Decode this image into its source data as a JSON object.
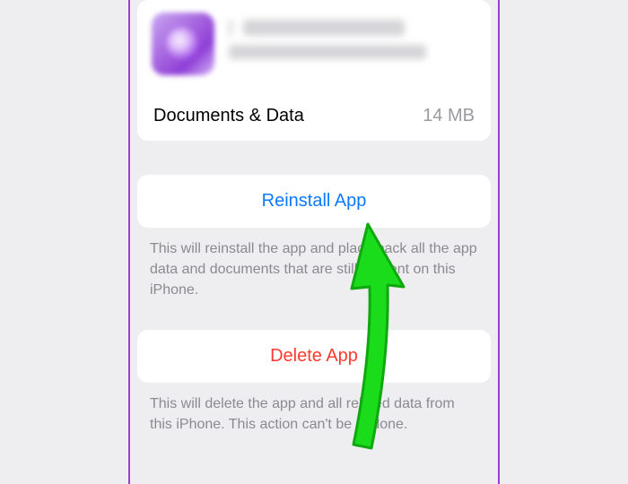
{
  "app_header": {
    "icon_name": "app-icon"
  },
  "docs": {
    "label": "Documents & Data",
    "value": "14 MB"
  },
  "reinstall": {
    "button_label": "Reinstall App",
    "caption": "This will reinstall the app and place back all the app data and documents that are still present on this iPhone."
  },
  "delete": {
    "button_label": "Delete App",
    "caption": "This will delete the app and all related data from this iPhone. This action can't be undone."
  },
  "arrow": {
    "color": "#1bdc1b",
    "stroke": "#0fa80f"
  }
}
